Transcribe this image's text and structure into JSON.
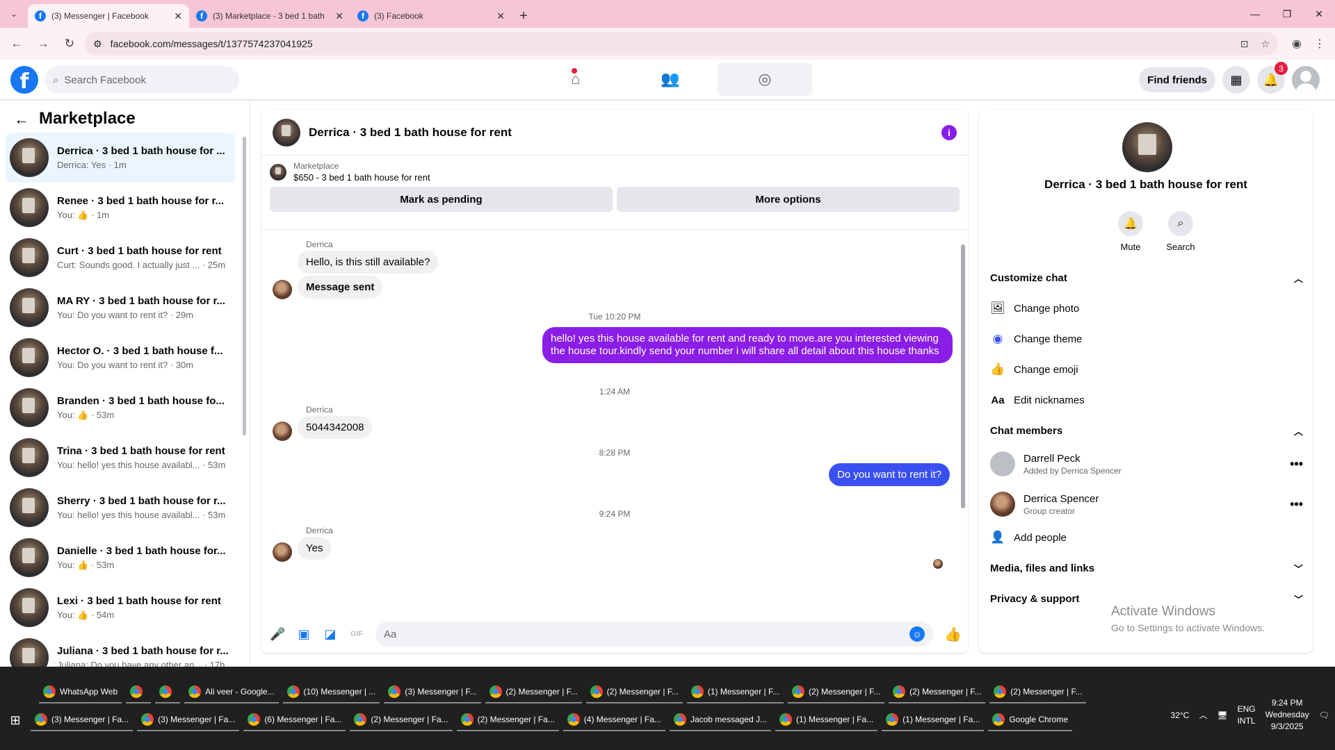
{
  "browser": {
    "tabs": [
      {
        "label": "(3) Messenger | Facebook",
        "active": true
      },
      {
        "label": "(3) Marketplace - 3 bed 1 bath",
        "active": false
      },
      {
        "label": "(3) Facebook",
        "active": false
      }
    ],
    "url": "facebook.com/messages/t/1377574237041925"
  },
  "fb": {
    "search_placeholder": "Search Facebook",
    "find_friends": "Find friends",
    "notif_count": "3"
  },
  "sidebar": {
    "title": "Marketplace",
    "conversations": [
      {
        "name": "Derrica · 3 bed 1 bath house for ...",
        "preview": "Derrica: Yes · 1m"
      },
      {
        "name": "Renee · 3 bed 1 bath house for r...",
        "preview": "You: 👍 · 1m"
      },
      {
        "name": "Curt · 3 bed 1 bath house for rent",
        "preview": "Curt: Sounds good. I actually just ... · 25m"
      },
      {
        "name": "MA RY · 3 bed 1 bath house for r...",
        "preview": "You: Do you want to rent it? · 29m"
      },
      {
        "name": "Hector O. · 3 bed 1 bath house f...",
        "preview": "You: Do you want to rent it? · 30m"
      },
      {
        "name": "Branden · 3 bed 1 bath house fo...",
        "preview": "You: 👍 · 53m"
      },
      {
        "name": "Trina · 3 bed 1 bath house for rent",
        "preview": "You: hello! yes this house availabl... · 53m"
      },
      {
        "name": "Sherry · 3 bed 1 bath house for r...",
        "preview": "You: hello! yes this house availabl... · 53m"
      },
      {
        "name": "Danielle · 3 bed 1 bath house for...",
        "preview": "You: 👍 · 53m"
      },
      {
        "name": "Lexi · 3 bed 1 bath house for rent",
        "preview": "You: 👍 · 54m"
      },
      {
        "name": "Juliana · 3 bed 1 bath house for r...",
        "preview": "Juliana: Do you have any other an... · 17h"
      }
    ]
  },
  "chat": {
    "title": "Derrica · 3 bed 1 bath house for rent",
    "marketplace_label": "Marketplace",
    "listing": "$650 - 3 bed 1 bath house for rent",
    "mark_pending": "Mark as pending",
    "more_options": "More options",
    "messages": {
      "sender1": "Derrica",
      "m1": "Hello, is this still available?",
      "m2": "Message sent",
      "ts1": "Tue 10:20 PM",
      "m3": "hello! yes this house available for rent and ready to move.are you interested viewing the house tour.kindly send your number i will share all detail about this house thanks",
      "ts2": "1:24 AM",
      "sender2": "Derrica",
      "m4": "5044342008",
      "ts3": "8:28 PM",
      "m5": "Do you want to rent it?",
      "ts4": "9:24 PM",
      "sender3": "Derrica",
      "m6": "Yes"
    },
    "composer_placeholder": "Aa"
  },
  "details": {
    "title": "Derrica · 3 bed 1 bath house for rent",
    "mute": "Mute",
    "search": "Search",
    "customize_chat": "Customize chat",
    "change_photo": "Change photo",
    "change_theme": "Change theme",
    "change_emoji": "Change emoji",
    "edit_nicknames": "Edit nicknames",
    "chat_members": "Chat members",
    "members": [
      {
        "name": "Darrell Peck",
        "sub": "Added by Derrica Spencer"
      },
      {
        "name": "Derrica Spencer",
        "sub": "Group creator"
      }
    ],
    "add_people": "Add people",
    "media": "Media, files and links",
    "privacy": "Privacy & support",
    "activate1": "Activate Windows",
    "activate2": "Go to Settings to activate Windows."
  },
  "taskbar": {
    "row1": [
      "WhatsApp Web",
      "",
      "",
      "Ali veer - Google...",
      "(10) Messenger | ...",
      "(3) Messenger | F...",
      "(2) Messenger | F...",
      "(2) Messenger | F...",
      "(1) Messenger | F...",
      "(2) Messenger | F...",
      "(2) Messenger | F...",
      "(2) Messenger | F..."
    ],
    "row2": [
      "(3) Messenger | Fa...",
      "(3) Messenger | Fa...",
      "(6) Messenger | Fa...",
      "(2) Messenger | Fa...",
      "(2) Messenger | Fa...",
      "(4) Messenger | Fa...",
      "Jacob messaged J...",
      "(1) Messenger | Fa...",
      "(1) Messenger | Fa...",
      "Google Chrome"
    ],
    "temp": "32°C",
    "lang1": "ENG",
    "lang2": "INTL",
    "time": "9:24 PM",
    "day": "Wednesday",
    "date": "9/3/2025"
  },
  "colors": {
    "accent": "#8a1de6",
    "fb_blue": "#1877f2",
    "bubble_blue": "#3a4ff0"
  }
}
